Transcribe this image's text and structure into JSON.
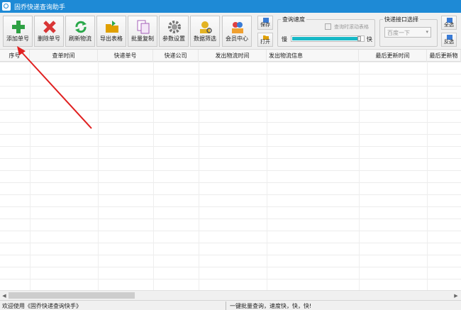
{
  "window": {
    "title": "固乔快递查询助手"
  },
  "toolbar": {
    "buttons": [
      {
        "label": "添加单号",
        "icon": "add-icon",
        "color": "#2ea043"
      },
      {
        "label": "删除单号",
        "icon": "delete-icon",
        "color": "#d93636"
      },
      {
        "label": "刷新物流",
        "icon": "refresh-icon",
        "color": "#2aa84a"
      },
      {
        "label": "导出表格",
        "icon": "export-icon",
        "color": "#e0a000"
      },
      {
        "label": "批量复制",
        "icon": "copy-icon",
        "color": "#a45fb8"
      },
      {
        "label": "参数设置",
        "icon": "gear-icon",
        "color": "#777777"
      },
      {
        "label": "数据筛选",
        "icon": "filter-icon",
        "color": "#e3b323"
      },
      {
        "label": "会员中心",
        "icon": "member-icon",
        "color": "#3a7bd5"
      }
    ],
    "save_label": "保存",
    "open_label": "打开"
  },
  "speed": {
    "title": "查询速度",
    "checkbox_label": "查询时滚动表格",
    "slow_label": "慢",
    "fast_label": "快",
    "level": 0.95
  },
  "api": {
    "title": "快递接口选择",
    "selected": "百度一下"
  },
  "select_all_label": "全选",
  "invert_label": "反选",
  "table": {
    "columns": [
      "序号",
      "查单时间",
      "快递单号",
      "快递公司",
      "发出物流时间",
      "发出物流信息",
      "最后更新时间",
      "最后更新物"
    ]
  },
  "status": {
    "left": "欢迎使用《固乔快递查询快手》",
    "right": "一键批量查询，速度快，快，快!"
  },
  "colors": {
    "titlebar": "#1e8ad6",
    "annotation_arrow": "#e02020",
    "progress": "#17b8c6"
  }
}
